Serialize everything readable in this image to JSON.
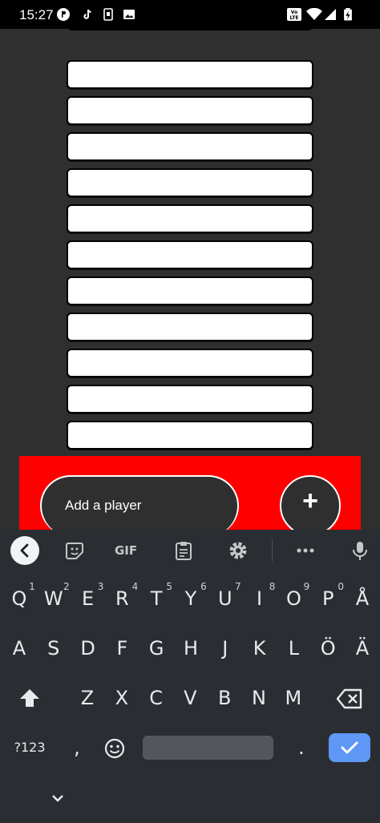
{
  "status_bar": {
    "time": "15:27",
    "icons": [
      "app-notification-icon",
      "tiktok-icon",
      "screenshot-icon",
      "gallery-icon",
      "volte-icon",
      "wifi-icon",
      "signal-icon",
      "battery-charging-icon"
    ],
    "volte_label": "VoLTE"
  },
  "app": {
    "player_slots": [
      "",
      "",
      "",
      "",
      "",
      "",
      "",
      "",
      "",
      "",
      ""
    ],
    "add_player_placeholder": "Add a player",
    "add_button_label": "+",
    "accent_color": "#ff0000",
    "background_color": "#2f2f2f"
  },
  "keyboard": {
    "toolbar_icons": [
      "back-chevron-icon",
      "sticker-icon",
      "gif-icon",
      "clipboard-icon",
      "settings-icon",
      "more-icon",
      "microphone-icon"
    ],
    "gif_label": "GIF",
    "row1": [
      "Q",
      "W",
      "E",
      "R",
      "T",
      "Y",
      "U",
      "I",
      "O",
      "P",
      "Å"
    ],
    "row1_hints": [
      "1",
      "2",
      "3",
      "4",
      "5",
      "6",
      "7",
      "8",
      "9",
      "0",
      ""
    ],
    "row2": [
      "A",
      "S",
      "D",
      "F",
      "G",
      "H",
      "J",
      "K",
      "L",
      "Ö",
      "Ä"
    ],
    "row3": [
      "Z",
      "X",
      "C",
      "V",
      "B",
      "N",
      "M"
    ],
    "symbols_label": "?123",
    "comma_label": ",",
    "period_label": ".",
    "enter_color": "#5e97f6"
  }
}
